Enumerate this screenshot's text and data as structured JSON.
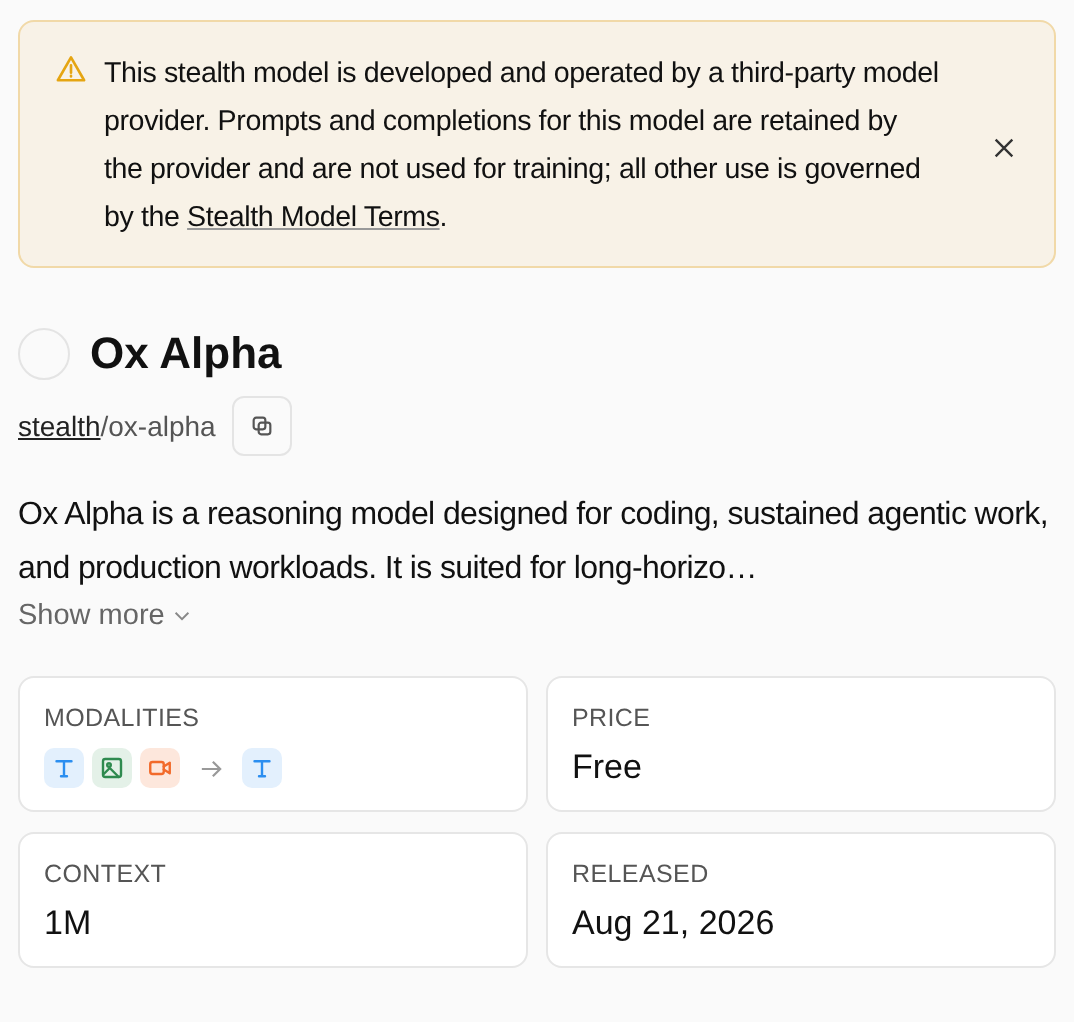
{
  "notice": {
    "text": "This stealth model is developed and operated by a third-party model provider. Prompts and completions for this model are retained by the provider and are not used for training; all other use is governed by the",
    "link": "Stealth Model Terms",
    "end": "."
  },
  "model": {
    "name": "Ox Alpha",
    "author": "stealth",
    "slug": "/ox-alpha",
    "description": "Ox Alpha is a reasoning model designed for coding, sustained agentic work, and production workloads. It is suited for long-horizo…",
    "show_more": "Show more"
  },
  "stats": [
    {
      "kind": "modalities",
      "label": "MODALITIES",
      "inputs": [
        {
          "kind": "text"
        },
        {
          "kind": "image"
        },
        {
          "kind": "video"
        }
      ],
      "outputs": [
        {
          "kind": "text"
        }
      ]
    },
    {
      "kind": "value",
      "label": "PRICE",
      "value": "Free"
    },
    {
      "kind": "value",
      "label": "CONTEXT",
      "value": "1M"
    },
    {
      "kind": "value",
      "label": "RELEASED",
      "value": "Aug 21, 2026"
    }
  ]
}
